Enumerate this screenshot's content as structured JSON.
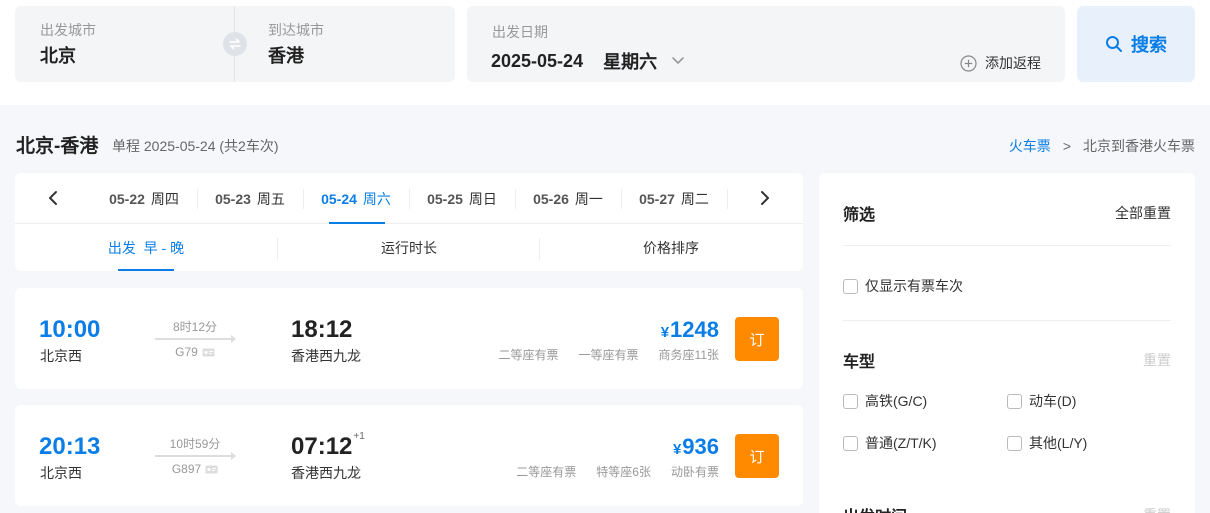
{
  "search": {
    "from_label": "出发城市",
    "from_city": "北京",
    "to_label": "到达城市",
    "to_city": "香港",
    "date_label": "出发日期",
    "date": "2025-05-24",
    "weekday": "星期六",
    "add_return": "添加返程",
    "search_button": "搜索"
  },
  "route": {
    "title": "北京-香港",
    "subtitle": "单程 2025-05-24 (共2车次)"
  },
  "breadcrumb": {
    "link": "火车票",
    "separator": ">",
    "current": "北京到香港火车票"
  },
  "date_tabs": [
    {
      "date": "05-22",
      "week": "周四",
      "active": false
    },
    {
      "date": "05-23",
      "week": "周五",
      "active": false
    },
    {
      "date": "05-24",
      "week": "周六",
      "active": true
    },
    {
      "date": "05-25",
      "week": "周日",
      "active": false
    },
    {
      "date": "05-26",
      "week": "周一",
      "active": false
    },
    {
      "date": "05-27",
      "week": "周二",
      "active": false
    }
  ],
  "sort": {
    "depart": "出发  早 - 晚",
    "duration": "运行时长",
    "price": "价格排序"
  },
  "trains": [
    {
      "dep_time": "10:00",
      "dep_station": "北京西",
      "duration": "8时12分",
      "train_no": "G79",
      "arr_time": "18:12",
      "arr_day": "",
      "arr_station": "香港西九龙",
      "currency": "¥",
      "price": "1248",
      "seats": [
        "二等座有票",
        "一等座有票",
        "商务座11张"
      ],
      "book": "订"
    },
    {
      "dep_time": "20:13",
      "dep_station": "北京西",
      "duration": "10时59分",
      "train_no": "G897",
      "arr_time": "07:12",
      "arr_day": "+1",
      "arr_station": "香港西九龙",
      "currency": "¥",
      "price": "936",
      "seats": [
        "二等座有票",
        "特等座6张",
        "动卧有票"
      ],
      "book": "订"
    }
  ],
  "filter": {
    "title": "筛选",
    "reset_all": "全部重置",
    "only_available": "仅显示有票车次",
    "train_type_title": "车型",
    "reset": "重置",
    "types": [
      "高铁(G/C)",
      "动车(D)",
      "普通(Z/T/K)",
      "其他(L/Y)"
    ],
    "depart_time_title": "出发时间"
  },
  "colors": {
    "accent": "#0a7ee6",
    "book_button": "#ff8a00"
  }
}
